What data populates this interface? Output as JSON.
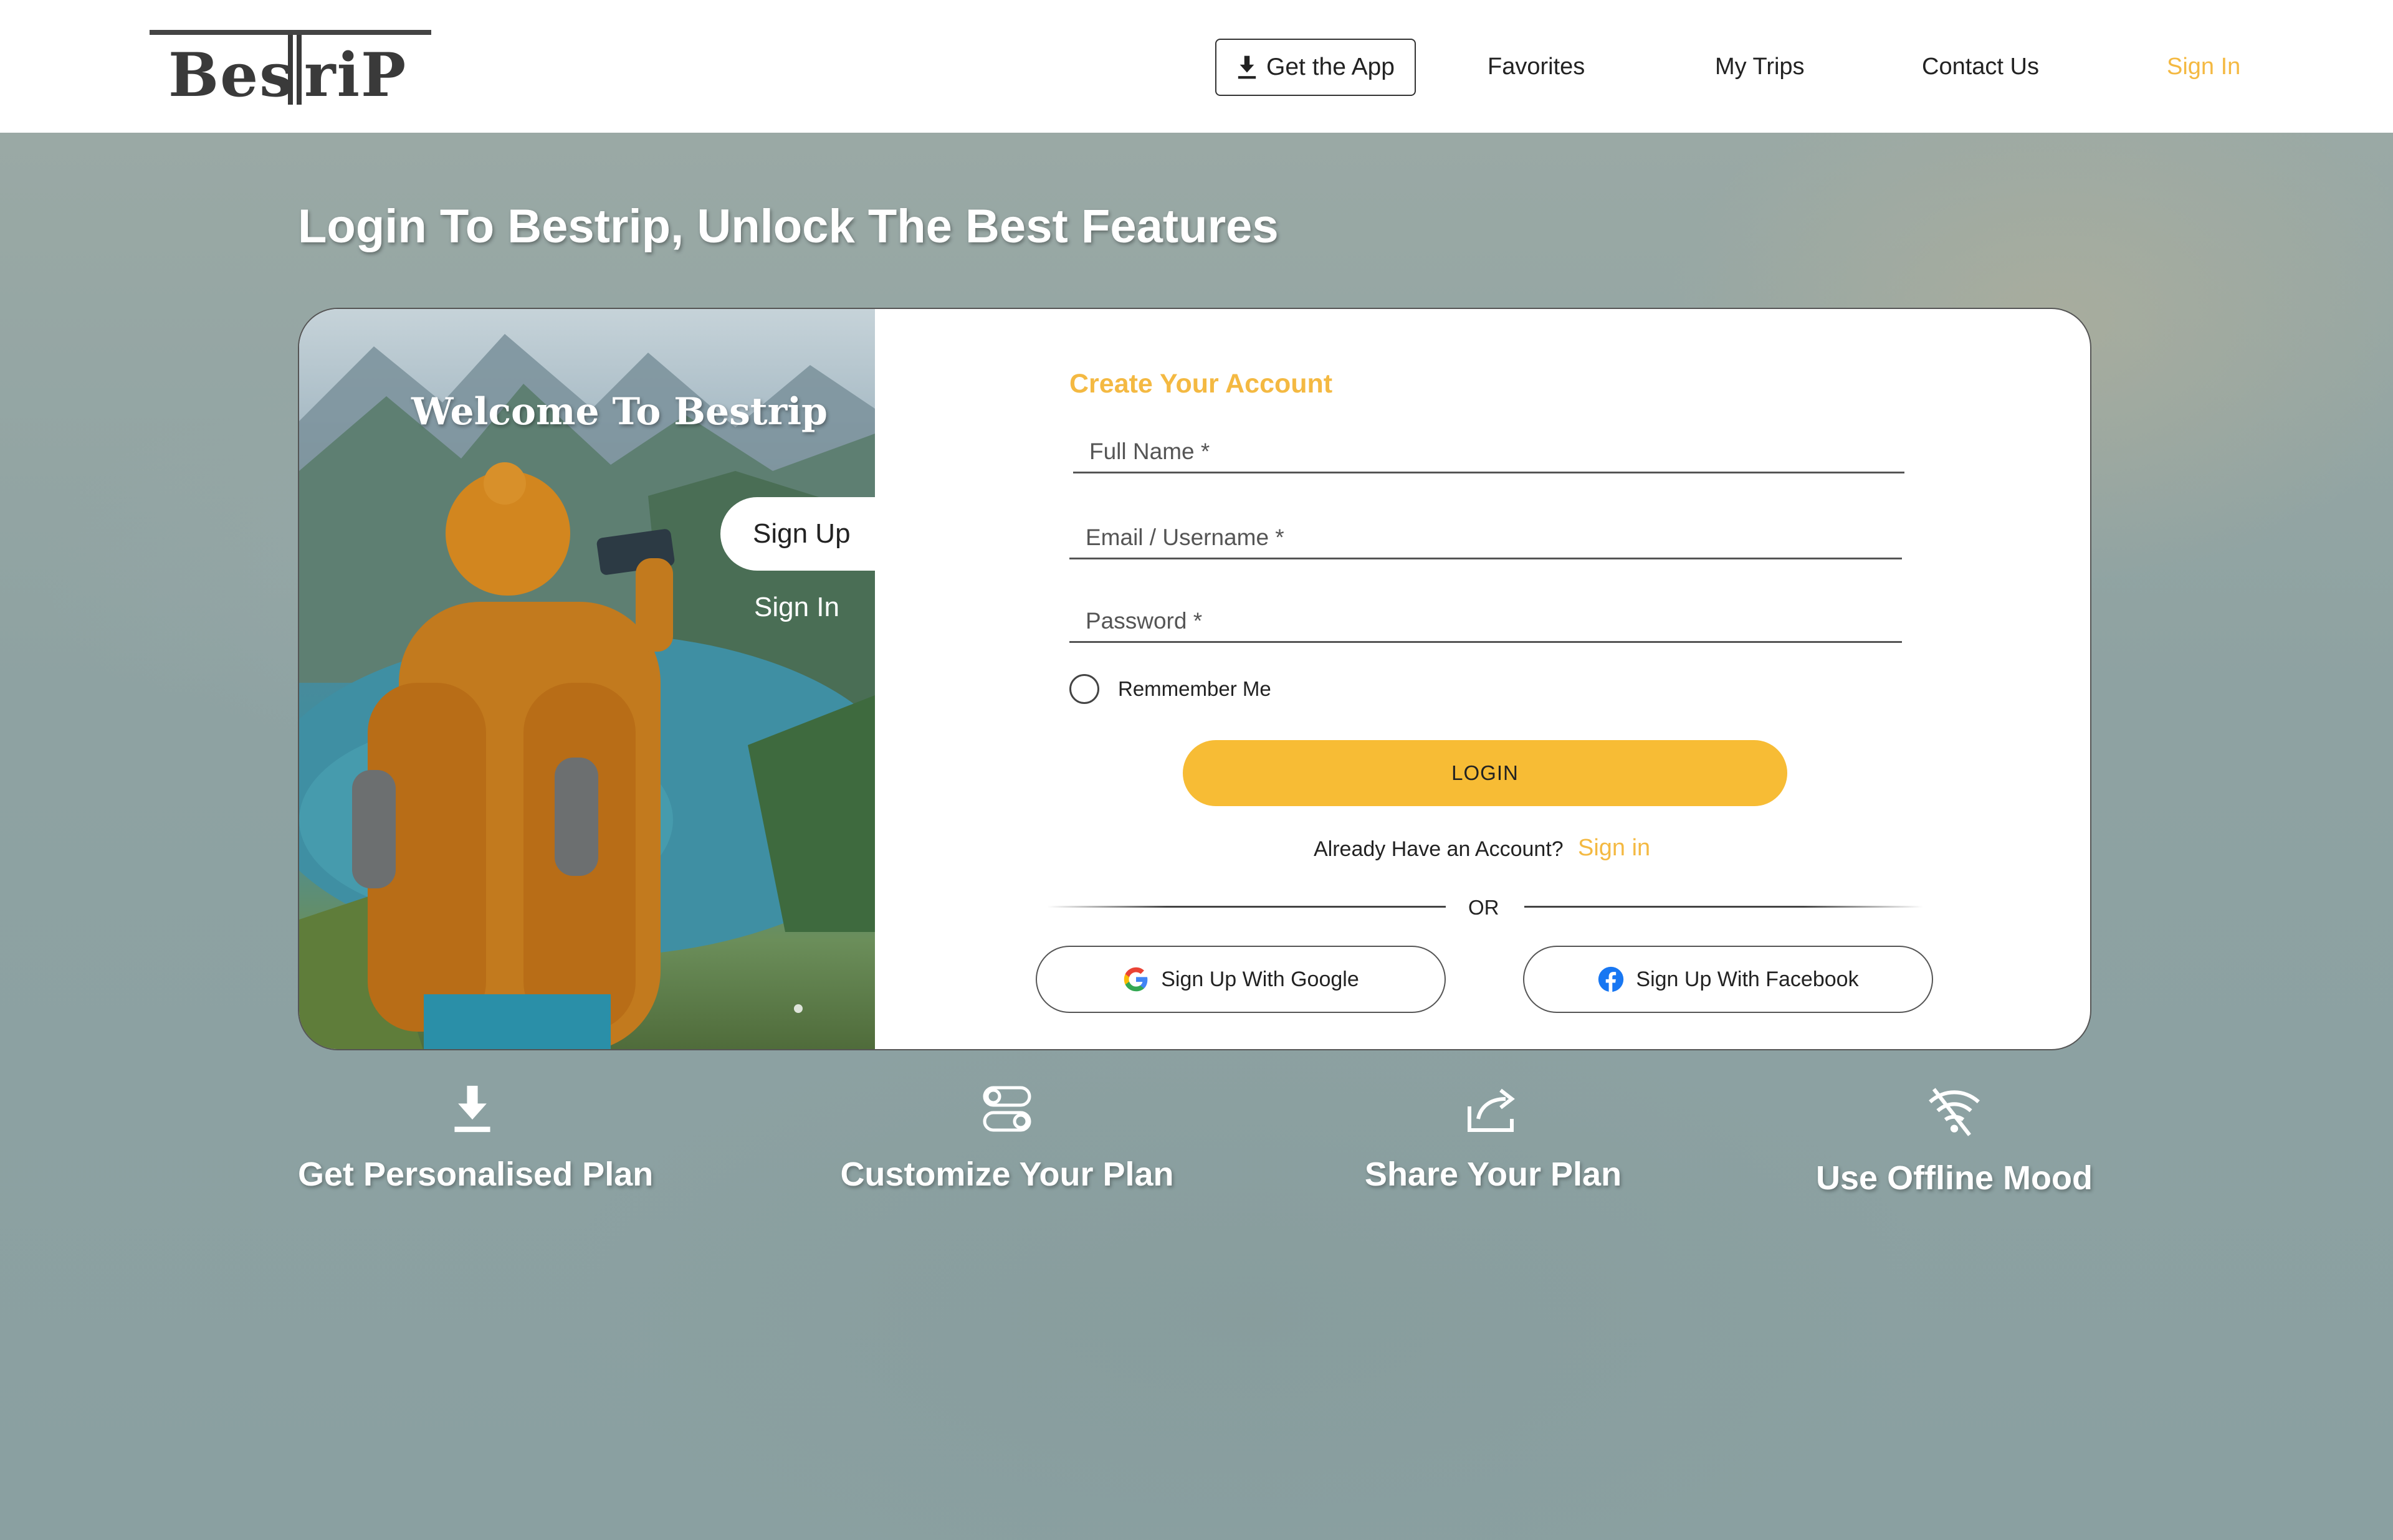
{
  "header": {
    "logo_left": "Bes",
    "logo_right": "riP",
    "get_app_label": "Get the App",
    "nav": [
      "Favorites",
      "My Trips",
      "Contact Us"
    ],
    "sign_in_label": "Sign In",
    "accent_color": "#f4b942"
  },
  "hero": {
    "title": "Login To Bestrip, Unlock The Best Features"
  },
  "card": {
    "welcome": "Welcome To Bestrip",
    "tab_signup": "Sign Up",
    "tab_signin": "Sign In",
    "form_title": "Create Your Account",
    "fields": {
      "full_name_placeholder": "Full Name *",
      "email_placeholder": "Email / Username *",
      "password_placeholder": "Password *"
    },
    "remember_label": "Remmember Me",
    "login_label": "LOGIN",
    "already_text": "Already Have an Account?",
    "signin_link": "Sign in",
    "or_text": "OR",
    "google_label": "Sign Up With Google",
    "facebook_label": "Sign Up With Facebook"
  },
  "features": [
    {
      "label": "Get Personalised Plan",
      "icon": "download-icon"
    },
    {
      "label": "Customize Your Plan",
      "icon": "toggle-icon"
    },
    {
      "label": "Share Your Plan",
      "icon": "share-icon"
    },
    {
      "label": "Use Offline Mood",
      "icon": "wifi-off-icon"
    }
  ]
}
